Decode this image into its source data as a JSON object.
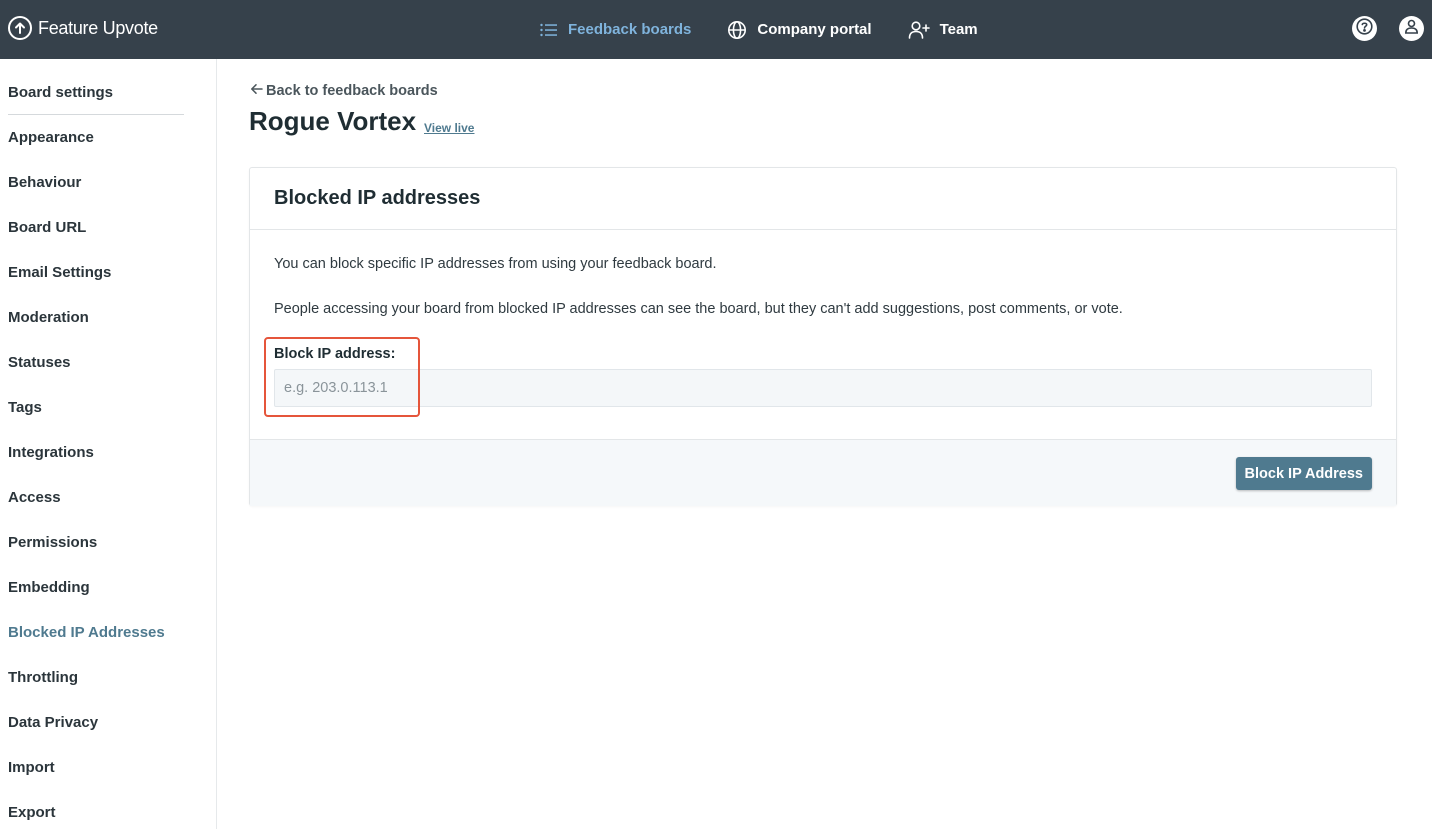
{
  "app": {
    "name": "Feature Upvote"
  },
  "nav": {
    "items": [
      {
        "label": "Feedback boards",
        "icon": "list-icon",
        "active": true
      },
      {
        "label": "Company portal",
        "icon": "globe-icon",
        "active": false
      },
      {
        "label": "Team",
        "icon": "add-user-icon",
        "active": false
      }
    ],
    "active_color": "#7fb3dc"
  },
  "topbar": {
    "help_icon": "help-icon",
    "account_icon": "user-icon",
    "background": "#36414b"
  },
  "sidebar": {
    "items": [
      {
        "label": "Board settings"
      },
      {
        "label": "Appearance"
      },
      {
        "label": "Behaviour"
      },
      {
        "label": "Board URL"
      },
      {
        "label": "Email Settings"
      },
      {
        "label": "Moderation"
      },
      {
        "label": "Statuses"
      },
      {
        "label": "Tags"
      },
      {
        "label": "Integrations"
      },
      {
        "label": "Access"
      },
      {
        "label": "Permissions"
      },
      {
        "label": "Embedding"
      },
      {
        "label": "Blocked IP Addresses",
        "active": true
      },
      {
        "label": "Throttling"
      },
      {
        "label": "Data Privacy"
      },
      {
        "label": "Import"
      },
      {
        "label": "Export"
      }
    ],
    "active_color": "#4f7a8f"
  },
  "page": {
    "back_label": "Back to feedback boards",
    "title": "Rogue Vortex",
    "view_live": "View live"
  },
  "card": {
    "title": "Blocked IP addresses",
    "paragraph1": "You can block specific IP addresses from using your feedback board.",
    "paragraph2": "People accessing your board from blocked IP addresses can see the board, but they can't add suggestions, post comments, or vote.",
    "field_label": "Block IP address:",
    "input_value": "",
    "input_placeholder": "e.g. 203.0.113.1",
    "button_label": "Block IP Address",
    "button_color": "#4f7a8f",
    "highlight_color": "#e5553b"
  }
}
